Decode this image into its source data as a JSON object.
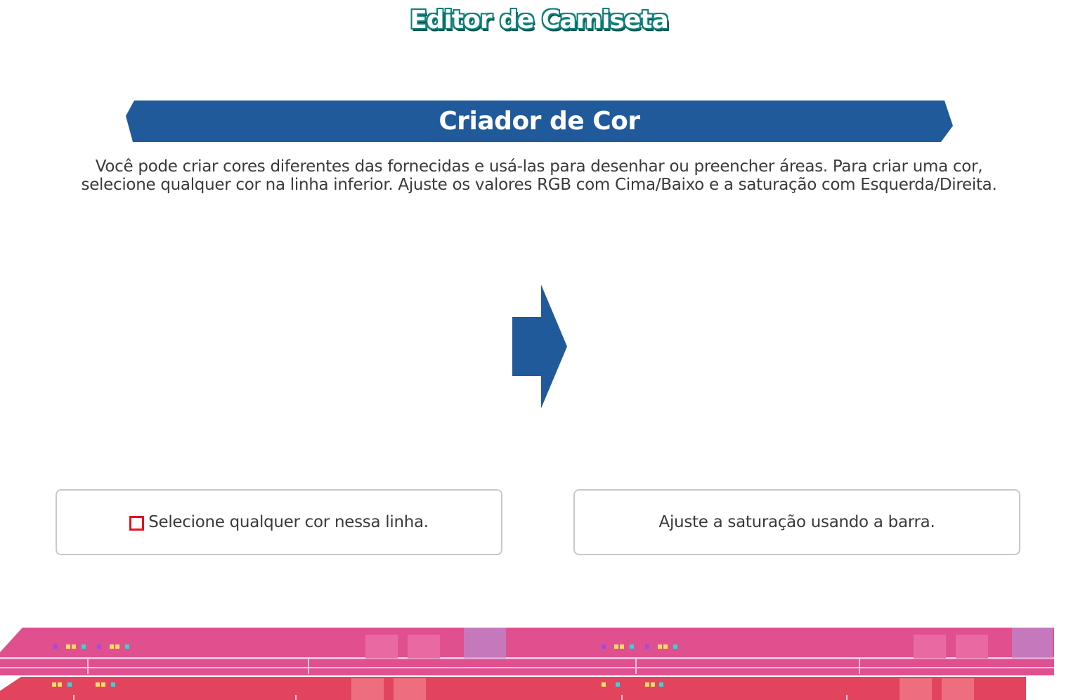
{
  "header": {
    "title": "Editor de Camiseta"
  },
  "section": {
    "title": "Criador de Cor",
    "description_line1": "Você pode criar cores diferentes das fornecidas e usá-las para desenhar ou preencher áreas. Para criar uma cor,",
    "description_line2": "selecione qualquer cor na linha inferior. Ajuste os valores RGB com Cima/Baixo e a saturação com Esquerda/Direita."
  },
  "steps": {
    "left_box": "Selecione qualquer cor nessa linha.",
    "right_box": "Ajuste a saturação usando a barra."
  },
  "icons": {
    "arrow": "right-arrow-icon",
    "marker": "red-square-icon"
  },
  "colors": {
    "title_fill": "#ffffff",
    "title_outline": "#0e7f7a",
    "banner": "#205a9a",
    "arrow": "#205a9a",
    "text": "#3a3a3a",
    "box_border": "#c8c8cc",
    "marker": "#e0141e",
    "palette_top": "#e0508e",
    "palette_bottom": "#e2445e"
  }
}
